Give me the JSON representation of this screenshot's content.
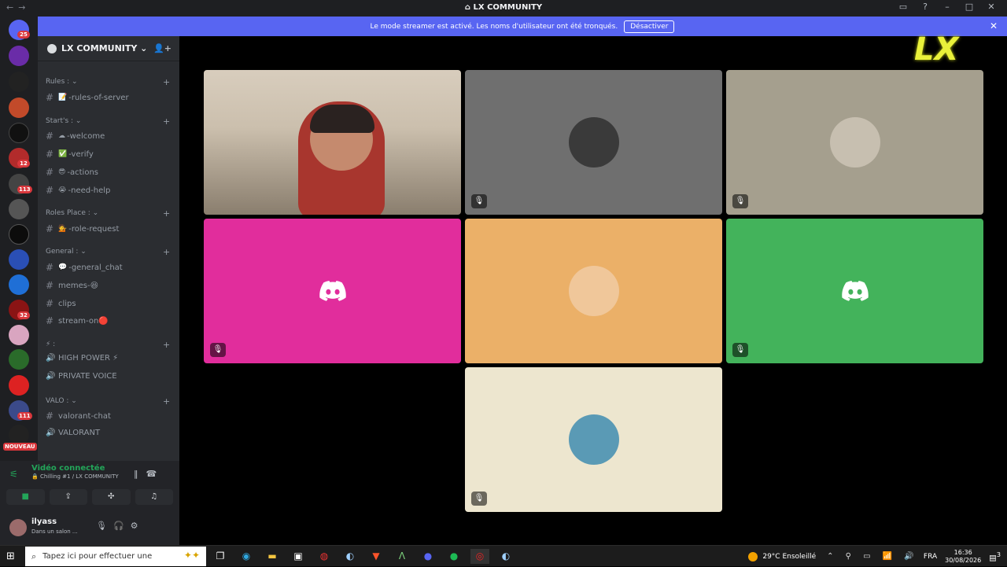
{
  "window": {
    "title": "LX COMMUNITY",
    "title_icon": "discord-icon"
  },
  "banner": {
    "text": "Le mode streamer est activé. Les noms d'utilisateur ont été tronqués.",
    "button": "Désactiver"
  },
  "servers": {
    "badges": [
      {
        "label": "25"
      },
      {
        "label": "12"
      },
      {
        "label": "113"
      },
      {
        "label": "32"
      },
      {
        "label": "111"
      }
    ],
    "new_label": "NOUVEAU"
  },
  "guild": {
    "name": "LX COMMUNITY",
    "categories": [
      {
        "name": "Rules :",
        "channels": [
          {
            "emoji": "📝",
            "name": "-rules-of-server",
            "type": "text"
          }
        ]
      },
      {
        "name": "Start's :",
        "channels": [
          {
            "emoji": "☁",
            "name": "-welcome",
            "type": "text"
          },
          {
            "emoji": "✅",
            "name": "-verify",
            "type": "text"
          },
          {
            "emoji": "😎",
            "name": "-actions",
            "type": "text"
          },
          {
            "emoji": "😭",
            "name": "-need-help",
            "type": "text"
          }
        ]
      },
      {
        "name": "Roles Place :",
        "channels": [
          {
            "emoji": "💁",
            "name": "-role-request",
            "type": "text"
          }
        ]
      },
      {
        "name": "General :",
        "channels": [
          {
            "emoji": "💬",
            "name": "-general_chat",
            "type": "text"
          },
          {
            "emoji": "",
            "name": "memes-😆",
            "type": "text"
          },
          {
            "emoji": "",
            "name": "clips",
            "type": "text"
          },
          {
            "emoji": "",
            "name": "stream-on🔴",
            "type": "text"
          }
        ]
      },
      {
        "name": "⚡ :",
        "channels": [
          {
            "emoji": "",
            "name": "HIGH POWER ⚡",
            "type": "voice"
          },
          {
            "emoji": "",
            "name": "PRIVATE VOICE",
            "type": "voice"
          }
        ]
      },
      {
        "name": "VALO :",
        "channels": [
          {
            "emoji": "",
            "name": "valorant-chat",
            "type": "text"
          },
          {
            "emoji": "",
            "name": "VALORANT",
            "type": "voice"
          }
        ]
      }
    ]
  },
  "voice": {
    "status": "Vidéo connectée",
    "location": "🔒 Chilling #1 / LX COMMUNITY"
  },
  "user": {
    "name": "ilyass",
    "status": "Dans un salon ..."
  },
  "stage": {
    "logo_text": "LX",
    "tiles": [
      {
        "kind": "webcam",
        "color": "#c9bca8",
        "muted": false
      },
      {
        "kind": "avatar",
        "color": "#6f6f6f",
        "avatar_color": "#3a3a3a",
        "muted": true
      },
      {
        "kind": "avatar",
        "color": "#a59f8e",
        "avatar_color": "#c7bfb0",
        "muted": true
      },
      {
        "kind": "discord",
        "color": "#e12d9c",
        "muted": true
      },
      {
        "kind": "avatar",
        "color": "#ebb068",
        "avatar_color": "#f0c79a",
        "muted": false
      },
      {
        "kind": "discord",
        "color": "#43b35b",
        "muted": true
      },
      {
        "kind": "avatar",
        "color": "#ede6cf",
        "avatar_color": "#5a9ab5",
        "muted": true
      }
    ]
  },
  "taskbar": {
    "search_placeholder": "Tapez ici pour effectuer une",
    "weather": "29°C Ensoleillé",
    "lang": "FRA",
    "time": "16:36",
    "date": "30/08/2026",
    "notif_count": "3"
  }
}
